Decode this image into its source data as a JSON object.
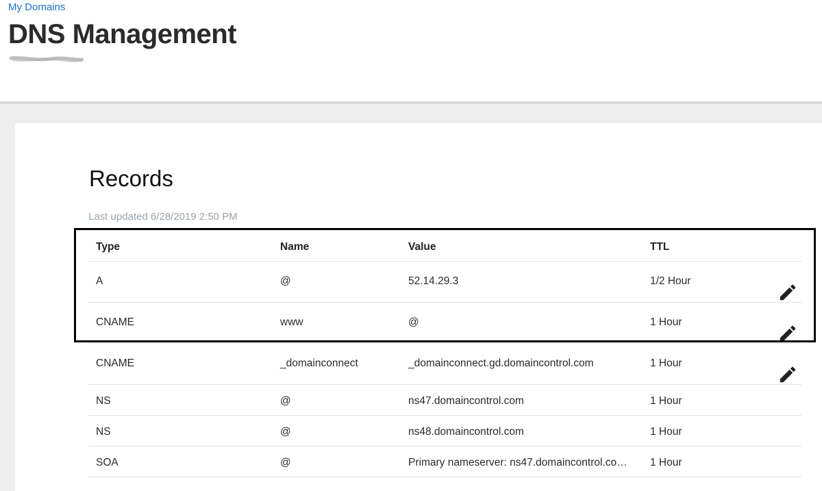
{
  "header": {
    "breadcrumb": "My Domains",
    "title": "DNS Management"
  },
  "records": {
    "title": "Records",
    "last_updated": "Last updated 6/28/2019 2:50 PM",
    "columns": {
      "type": "Type",
      "name": "Name",
      "value": "Value",
      "ttl": "TTL"
    },
    "rows": [
      {
        "type": "A",
        "name": "@",
        "value": "52.14.29.3",
        "ttl": "1/2 Hour",
        "editable": true
      },
      {
        "type": "CNAME",
        "name": "www",
        "value": "@",
        "ttl": "1 Hour",
        "editable": true
      },
      {
        "type": "CNAME",
        "name": "_domainconnect",
        "value": "_domainconnect.gd.domaincontrol.com",
        "ttl": "1 Hour",
        "editable": true
      },
      {
        "type": "NS",
        "name": "@",
        "value": "ns47.domaincontrol.com",
        "ttl": "1 Hour",
        "editable": false
      },
      {
        "type": "NS",
        "name": "@",
        "value": "ns48.domaincontrol.com",
        "ttl": "1 Hour",
        "editable": false
      },
      {
        "type": "SOA",
        "name": "@",
        "value": "Primary nameserver: ns47.domaincontrol.co…",
        "ttl": "1 Hour",
        "editable": false
      }
    ]
  },
  "icons": {
    "edit": "pencil-icon"
  },
  "colors": {
    "link": "#1a73c8",
    "muted": "#9aa3ab",
    "highlight_border": "#000000"
  }
}
